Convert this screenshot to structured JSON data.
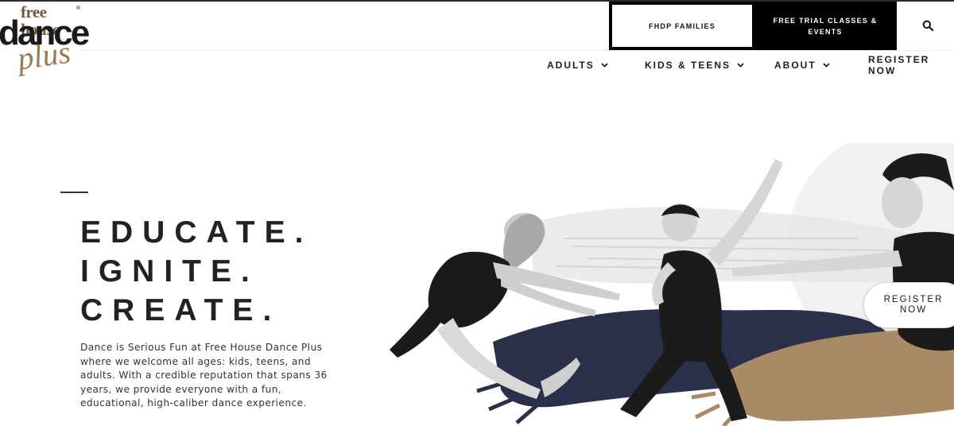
{
  "logo": {
    "line1": "free house",
    "registered": "®",
    "line2": "dance",
    "line3": "plus"
  },
  "header": {
    "families_label": "FHDP FAMILIES",
    "trial_label": "FREE TRIAL CLASSES & EVENTS",
    "search_icon": "search-icon"
  },
  "nav": {
    "items": [
      {
        "label": "ADULTS",
        "has_dropdown": true
      },
      {
        "label": "KIDS & TEENS",
        "has_dropdown": true
      },
      {
        "label": "ABOUT",
        "has_dropdown": true
      },
      {
        "label": "REGISTER NOW",
        "has_dropdown": false
      }
    ]
  },
  "hero": {
    "headline": [
      "EDUCATE.",
      "IGNITE.",
      "CREATE."
    ],
    "intro": "Dance is Serious Fun at Free House Dance Plus where we welcome all ages: kids, teens, and adults. With a credible reputation that spans 36 years, we provide everyone with a fun, educational, high-caliber dance experience.",
    "register_label": "REGISTER NOW"
  },
  "colors": {
    "brand_brown": "#6f5a3c",
    "brand_gold": "#9a7a50",
    "navy_paint": "#2a2f4a",
    "gold_paint": "#a88a64",
    "black": "#000000"
  }
}
